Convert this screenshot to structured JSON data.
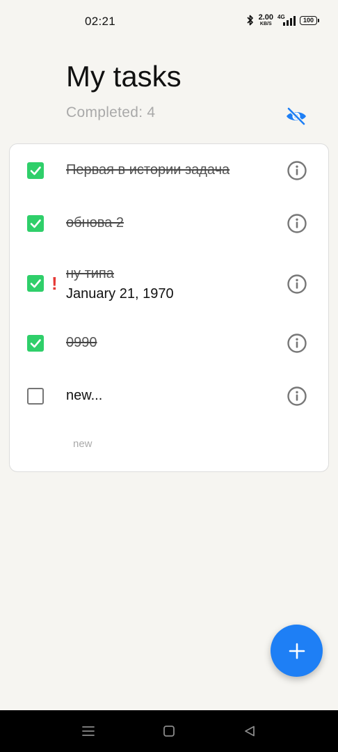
{
  "status_bar": {
    "time": "02:21",
    "net_speed_value": "2.00",
    "net_speed_unit": "KB/S",
    "network_type": "4G",
    "battery": "100",
    "icons": [
      "bluetooth-icon",
      "signal-icon",
      "battery-icon"
    ]
  },
  "header": {
    "title": "My tasks",
    "completed_label": "Completed:",
    "completed_count": "4",
    "visibility_icon": "eye-off-icon",
    "accent_color": "#1e7ff5"
  },
  "tasks": [
    {
      "title": "Первая в истории задача",
      "done": true,
      "priority": false,
      "date": ""
    },
    {
      "title": "обнова 2",
      "done": true,
      "priority": false,
      "date": ""
    },
    {
      "title": "ну типа",
      "done": true,
      "priority": true,
      "priority_mark": "!",
      "date": "January 21, 1970"
    },
    {
      "title": "0990",
      "done": true,
      "priority": false,
      "date": ""
    },
    {
      "title": "new...",
      "done": false,
      "priority": false,
      "date": ""
    }
  ],
  "new_task_placeholder": "new",
  "colors": {
    "checked": "#2fcf6a",
    "priority": "#e53935",
    "fab": "#1e7ff5",
    "background": "#f6f5f1"
  },
  "fab": {
    "icon": "plus-icon"
  },
  "nav_bar": {
    "icons": [
      "menu-icon",
      "home-icon",
      "back-icon"
    ]
  }
}
